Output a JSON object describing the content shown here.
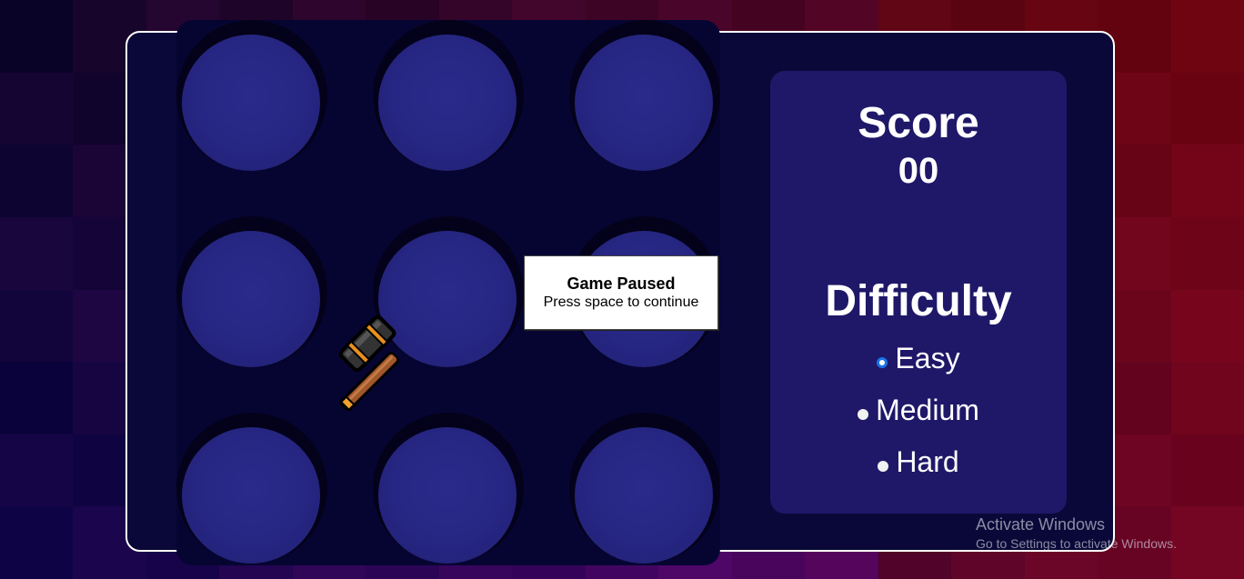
{
  "score_panel": {
    "title": "Score",
    "value": "00"
  },
  "difficulty": {
    "title": "Difficulty",
    "options": [
      {
        "label": "Easy",
        "selected": true
      },
      {
        "label": "Medium",
        "selected": false
      },
      {
        "label": "Hard",
        "selected": false
      }
    ]
  },
  "pause_dialog": {
    "title": "Game Paused",
    "subtitle": "Press space to continue"
  },
  "holes": {
    "count": 9,
    "rows": 3,
    "cols": 3
  },
  "cursor": {
    "icon": "hammer-icon"
  },
  "watermark": {
    "title": "Activate Windows",
    "subtitle": "Go to Settings to activate Windows."
  },
  "colors": {
    "panel": "#1f1868",
    "board": "#060532",
    "hole": "#262683",
    "container": "#0a0838",
    "radio_accent": "#1a73e8"
  }
}
